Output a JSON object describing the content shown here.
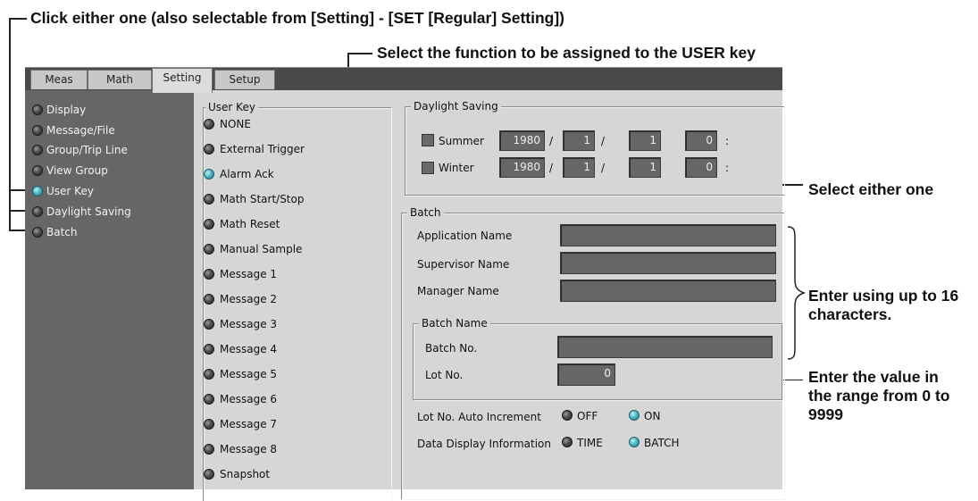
{
  "callouts": {
    "top": "Click either one (also selectable from [Setting] - [SET [Regular] Setting])",
    "second": "Select the function to be assigned to the USER key",
    "select_either": "Select either one",
    "enter_chars": "Enter using up to 16 characters.",
    "enter_value": "Enter the value in the range from 0 to 9999"
  },
  "tabs": [
    "Meas",
    "Math",
    "Setting",
    "Setup"
  ],
  "active_tab": "Setting",
  "left_menu": [
    {
      "label": "Display",
      "selected": false
    },
    {
      "label": "Message/File",
      "selected": false
    },
    {
      "label": "Group/Trip Line",
      "selected": false
    },
    {
      "label": "View Group",
      "selected": false
    },
    {
      "label": "User Key",
      "selected": true
    },
    {
      "label": "Daylight Saving",
      "selected": false
    },
    {
      "label": "Batch",
      "selected": false
    }
  ],
  "user_key": {
    "title": "User Key",
    "items": [
      {
        "label": "NONE",
        "selected": false
      },
      {
        "label": "External Trigger",
        "selected": false
      },
      {
        "label": "Alarm Ack",
        "selected": true
      },
      {
        "label": "Math Start/Stop",
        "selected": false
      },
      {
        "label": "Math Reset",
        "selected": false
      },
      {
        "label": "Manual Sample",
        "selected": false
      },
      {
        "label": "Message 1",
        "selected": false
      },
      {
        "label": "Message 2",
        "selected": false
      },
      {
        "label": "Message 3",
        "selected": false
      },
      {
        "label": "Message 4",
        "selected": false
      },
      {
        "label": "Message 5",
        "selected": false
      },
      {
        "label": "Message 6",
        "selected": false
      },
      {
        "label": "Message 7",
        "selected": false
      },
      {
        "label": "Message 8",
        "selected": false
      },
      {
        "label": "Snapshot",
        "selected": false
      }
    ]
  },
  "daylight": {
    "title": "Daylight Saving",
    "summer": {
      "label": "Summer",
      "year": "1980",
      "month": "1",
      "day": "1",
      "hour": "0"
    },
    "winter": {
      "label": "Winter",
      "year": "1980",
      "month": "1",
      "day": "1",
      "hour": "0"
    },
    "sep": "/",
    "colon": ":"
  },
  "batch": {
    "title": "Batch",
    "app_label": "Application Name",
    "app_value": "",
    "sup_label": "Supervisor Name",
    "sup_value": "",
    "mgr_label": "Manager Name",
    "mgr_value": "",
    "batch_name_title": "Batch Name",
    "batch_no_label": "Batch No.",
    "batch_no_value": "",
    "lot_no_label": "Lot No.",
    "lot_no_value": "0",
    "auto_inc_label": "Lot No. Auto Increment",
    "auto_inc_off": "OFF",
    "auto_inc_on": "ON",
    "display_info_label": "Data Display Information",
    "display_time": "TIME",
    "display_batch": "BATCH"
  },
  "colors": {
    "radio_on": "#4cb8c8",
    "radio_off": "#333333",
    "left_panel": "#666666",
    "panel": "#d6d6d6"
  }
}
